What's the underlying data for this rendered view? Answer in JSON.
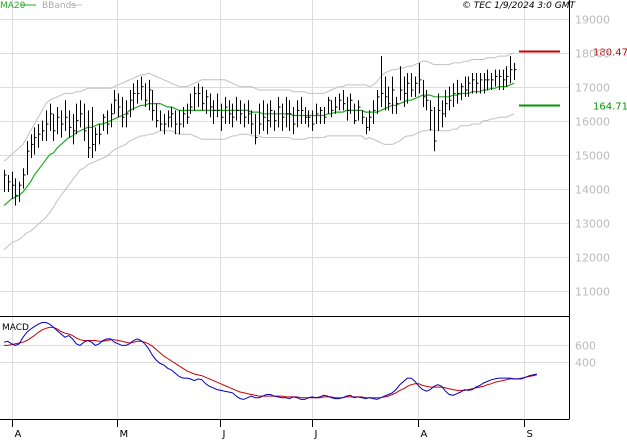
{
  "header": {
    "copyright": "© TEC 1/9/2024 3:0 GMT",
    "legend_ma20": "MA20",
    "legend_bbands": "BBands"
  },
  "colors": {
    "price": "#000000",
    "ma20": "#22aa22",
    "bands": "#c0c0c0",
    "macd_line": "#0000cc",
    "signal_line": "#cc0000",
    "resistance": "#cc0000",
    "support": "#009900",
    "ticks": "#bbbbbb"
  },
  "chart_data": [
    {
      "type": "line",
      "title": "",
      "y_ticks": [
        "19000",
        "18000",
        "17000",
        "16000",
        "15000",
        "14000",
        "13000",
        "12000",
        "11000"
      ],
      "y_tick_values": [
        19000,
        18000,
        17000,
        16000,
        15000,
        14000,
        13000,
        12000,
        11000
      ],
      "ylim": [
        10250,
        19550
      ],
      "x_months": [
        "A",
        "M",
        "J",
        "J",
        "A",
        "S"
      ],
      "price_high": [
        14550,
        14400,
        14500,
        14300,
        14200,
        14600,
        15400,
        15600,
        15800,
        15900,
        16000,
        16300,
        16500,
        16200,
        16400,
        16300,
        16600,
        16300,
        16200,
        16500,
        16600,
        16500,
        16300,
        16400,
        15800,
        15900,
        16200,
        16300,
        16500,
        16900,
        16800,
        16700,
        16600,
        16900,
        17100,
        17200,
        17300,
        17100,
        17200,
        16900,
        16500,
        16300,
        16200,
        16300,
        16400,
        16300,
        16300,
        16400,
        16500,
        16800,
        17000,
        17100,
        17000,
        16900,
        16800,
        16600,
        16800,
        16500,
        16700,
        16600,
        16500,
        16700,
        16600,
        16500,
        16600,
        16300,
        16200,
        16500,
        16600,
        16500,
        16600,
        16300,
        16700,
        16500,
        16700,
        16600,
        16400,
        16600,
        16700,
        16400,
        16300,
        16300,
        16500,
        16400,
        16400,
        16700,
        16600,
        16700,
        16800,
        16900,
        16700,
        16800,
        16500,
        16600,
        16300,
        16100,
        16300,
        16600,
        16900,
        17900,
        17300,
        17000,
        17300,
        16700,
        17600,
        17300,
        17400,
        17400,
        17300,
        17700,
        17200,
        16900,
        16600,
        16400,
        16800,
        16600,
        16900,
        17000,
        17100,
        17200,
        17100,
        17300,
        17300,
        17400,
        17400,
        17400,
        17400,
        17500,
        17400,
        17500,
        17500,
        17500,
        17600,
        17900,
        17700
      ],
      "price_low": [
        13900,
        13900,
        13700,
        13500,
        13600,
        14000,
        14400,
        14900,
        15000,
        15200,
        15400,
        15400,
        15700,
        15400,
        15600,
        15500,
        15700,
        15500,
        15300,
        15600,
        15800,
        15400,
        14900,
        14900,
        15100,
        15300,
        15700,
        15600,
        15800,
        16200,
        16100,
        15800,
        15800,
        16100,
        16300,
        16500,
        16600,
        16400,
        16300,
        16000,
        15800,
        15700,
        15600,
        15800,
        15800,
        15600,
        15600,
        15800,
        15900,
        16200,
        16300,
        16400,
        16300,
        16200,
        16100,
        15900,
        16100,
        15700,
        15900,
        15900,
        15800,
        16000,
        15900,
        15800,
        15900,
        15600,
        15300,
        15600,
        15700,
        15600,
        15800,
        15700,
        15800,
        15700,
        15800,
        15700,
        15600,
        15800,
        15900,
        15900,
        15800,
        15700,
        15900,
        15900,
        15900,
        16200,
        16100,
        16200,
        16300,
        16300,
        16000,
        16200,
        15900,
        16000,
        15900,
        15600,
        15700,
        15900,
        16200,
        16400,
        16300,
        16300,
        16200,
        16200,
        16600,
        16400,
        16500,
        16700,
        16700,
        16800,
        16400,
        16300,
        15700,
        15100,
        15700,
        15800,
        16100,
        16300,
        16400,
        16500,
        16600,
        16700,
        16700,
        16800,
        16800,
        16800,
        16800,
        16900,
        16900,
        17000,
        16900,
        16900,
        17000,
        17100,
        17200
      ],
      "price_close": [
        14400,
        14200,
        14100,
        13800,
        14100,
        14400,
        15100,
        15300,
        15500,
        15600,
        15700,
        15900,
        16200,
        15700,
        16100,
        15900,
        16100,
        15800,
        15700,
        16000,
        16200,
        15700,
        15200,
        15300,
        15600,
        15600,
        16100,
        15900,
        16200,
        16600,
        16400,
        16100,
        16200,
        16600,
        16800,
        16800,
        17000,
        16600,
        16900,
        16300,
        16000,
        15900,
        15900,
        16100,
        16200,
        15900,
        15900,
        16200,
        16100,
        16400,
        16800,
        16800,
        16500,
        16700,
        16400,
        16300,
        16300,
        16100,
        16400,
        16200,
        16100,
        16300,
        16200,
        16100,
        16200,
        15900,
        15500,
        15900,
        16100,
        16000,
        16300,
        16000,
        16400,
        16100,
        16200,
        16200,
        15900,
        16300,
        16300,
        16100,
        16100,
        15900,
        16200,
        16300,
        16100,
        16600,
        16300,
        16400,
        16600,
        16500,
        16300,
        16600,
        16000,
        16400,
        16100,
        15800,
        16100,
        16300,
        16700,
        16800,
        16700,
        16500,
        16900,
        16500,
        16900,
        16800,
        17100,
        16900,
        17100,
        17200,
        16700,
        16600,
        16300,
        15400,
        16300,
        16200,
        16500,
        16600,
        16800,
        16800,
        17000,
        16900,
        17100,
        17200,
        17100,
        17200,
        17200,
        17200,
        17200,
        17300,
        17300,
        17200,
        17300,
        17500,
        17500
      ],
      "ma20": [
        13500,
        13600,
        13700,
        13750,
        13800,
        13900,
        14050,
        14200,
        14400,
        14550,
        14700,
        14850,
        15000,
        15050,
        15200,
        15300,
        15400,
        15500,
        15550,
        15650,
        15700,
        15750,
        15800,
        15800,
        15850,
        15900,
        15900,
        15950,
        16000,
        16050,
        16100,
        16150,
        16200,
        16300,
        16350,
        16400,
        16450,
        16450,
        16500,
        16500,
        16500,
        16500,
        16450,
        16400,
        16400,
        16350,
        16300,
        16300,
        16300,
        16300,
        16300,
        16300,
        16300,
        16300,
        16300,
        16300,
        16300,
        16300,
        16300,
        16300,
        16300,
        16300,
        16300,
        16300,
        16300,
        16250,
        16250,
        16250,
        16200,
        16200,
        16200,
        16200,
        16200,
        16200,
        16200,
        16200,
        16150,
        16150,
        16150,
        16150,
        16150,
        16150,
        16150,
        16150,
        16150,
        16200,
        16200,
        16250,
        16250,
        16250,
        16300,
        16300,
        16300,
        16300,
        16300,
        16250,
        16250,
        16250,
        16250,
        16300,
        16350,
        16400,
        16450,
        16450,
        16500,
        16550,
        16600,
        16600,
        16650,
        16700,
        16750,
        16750,
        16750,
        16700,
        16700,
        16700,
        16700,
        16700,
        16750,
        16750,
        16800,
        16800,
        16800,
        16850,
        16850,
        16850,
        16900,
        16900,
        16950,
        16950,
        17000,
        17000,
        17000,
        17050,
        17100
      ],
      "bb_upper": [
        14800,
        14900,
        15000,
        15100,
        15200,
        15300,
        15500,
        15700,
        15900,
        16100,
        16300,
        16500,
        16600,
        16650,
        16700,
        16750,
        16800,
        16800,
        16800,
        16850,
        16850,
        16900,
        16950,
        16950,
        16950,
        16950,
        16950,
        16950,
        16950,
        17000,
        17050,
        17100,
        17150,
        17200,
        17250,
        17300,
        17350,
        17350,
        17400,
        17350,
        17300,
        17250,
        17200,
        17150,
        17100,
        17050,
        17000,
        17000,
        17000,
        17050,
        17100,
        17150,
        17200,
        17200,
        17200,
        17200,
        17200,
        17200,
        17200,
        17150,
        17100,
        17050,
        17000,
        17000,
        17000,
        17000,
        16950,
        16900,
        16900,
        16900,
        16900,
        16900,
        16900,
        16900,
        16900,
        16900,
        16850,
        16850,
        16850,
        16850,
        16800,
        16800,
        16800,
        16800,
        16800,
        16850,
        16900,
        16950,
        17000,
        17000,
        17050,
        17050,
        17050,
        17050,
        17050,
        17050,
        17000,
        17050,
        17150,
        17300,
        17400,
        17450,
        17500,
        17500,
        17550,
        17550,
        17600,
        17600,
        17650,
        17700,
        17750,
        17750,
        17700,
        17650,
        17650,
        17650,
        17650,
        17650,
        17700,
        17700,
        17700,
        17750,
        17750,
        17800,
        17800,
        17800,
        17800,
        17850,
        17850,
        17850,
        17900,
        17900,
        17900,
        17950,
        18000
      ],
      "bb_lower": [
        12200,
        12300,
        12400,
        12450,
        12500,
        12600,
        12700,
        12750,
        12850,
        12950,
        13050,
        13150,
        13300,
        13450,
        13650,
        13800,
        13950,
        14100,
        14250,
        14400,
        14550,
        14600,
        14700,
        14750,
        14800,
        14850,
        14900,
        14950,
        15050,
        15150,
        15200,
        15250,
        15300,
        15400,
        15450,
        15500,
        15550,
        15550,
        15600,
        15600,
        15650,
        15700,
        15700,
        15700,
        15700,
        15650,
        15600,
        15600,
        15600,
        15600,
        15550,
        15500,
        15450,
        15450,
        15450,
        15450,
        15450,
        15450,
        15450,
        15500,
        15550,
        15550,
        15600,
        15600,
        15600,
        15550,
        15550,
        15550,
        15500,
        15500,
        15500,
        15500,
        15500,
        15500,
        15500,
        15500,
        15450,
        15450,
        15450,
        15450,
        15500,
        15500,
        15500,
        15500,
        15500,
        15550,
        15550,
        15550,
        15550,
        15550,
        15550,
        15550,
        15550,
        15550,
        15550,
        15450,
        15500,
        15450,
        15400,
        15350,
        15300,
        15300,
        15300,
        15350,
        15400,
        15500,
        15550,
        15550,
        15600,
        15650,
        15700,
        15700,
        15750,
        15700,
        15700,
        15700,
        15700,
        15700,
        15750,
        15750,
        15850,
        15850,
        15850,
        15900,
        15900,
        15900,
        16000,
        16000,
        16050,
        16050,
        16100,
        16100,
        16100,
        16150,
        16200
      ],
      "levels": [
        {
          "name": "resistance",
          "value": 18047,
          "label": "180.47"
        },
        {
          "name": "support",
          "value": 16471,
          "label": "164.71"
        }
      ]
    },
    {
      "type": "line",
      "title": "MACD",
      "y_ticks": [
        "600",
        "400"
      ],
      "y_tick_values": [
        600,
        400
      ],
      "ylim": [
        -300,
        960
      ],
      "macd": [
        640,
        650,
        620,
        600,
        620,
        700,
        760,
        800,
        830,
        860,
        880,
        880,
        860,
        820,
        780,
        740,
        700,
        720,
        680,
        620,
        600,
        640,
        660,
        640,
        600,
        620,
        660,
        680,
        680,
        640,
        620,
        600,
        600,
        620,
        660,
        680,
        660,
        620,
        560,
        480,
        420,
        380,
        360,
        320,
        300,
        260,
        220,
        200,
        200,
        190,
        170,
        190,
        180,
        130,
        100,
        80,
        60,
        50,
        40,
        30,
        20,
        -20,
        -50,
        -60,
        -40,
        -20,
        -40,
        -40,
        -20,
        0,
        0,
        -20,
        -30,
        -40,
        -40,
        -50,
        -30,
        -40,
        -60,
        -60,
        -40,
        -30,
        -40,
        -30,
        -10,
        -20,
        -40,
        -50,
        -50,
        -40,
        -20,
        -10,
        -40,
        -30,
        -40,
        -50,
        -40,
        -50,
        -60,
        -40,
        -20,
        0,
        20,
        60,
        120,
        160,
        200,
        200,
        160,
        100,
        60,
        40,
        60,
        100,
        120,
        100,
        40,
        0,
        -10,
        10,
        30,
        60,
        50,
        60,
        90,
        110,
        140,
        160,
        180,
        190,
        200,
        200,
        200,
        200,
        190,
        190,
        190,
        210,
        230,
        240,
        250
      ],
      "signal": [
        600,
        600,
        610,
        620,
        630,
        640,
        660,
        690,
        720,
        760,
        790,
        810,
        820,
        820,
        800,
        770,
        750,
        740,
        720,
        690,
        670,
        660,
        660,
        660,
        660,
        650,
        650,
        660,
        670,
        670,
        660,
        650,
        640,
        630,
        640,
        650,
        650,
        640,
        620,
        590,
        550,
        510,
        470,
        440,
        410,
        380,
        350,
        320,
        290,
        270,
        250,
        240,
        230,
        210,
        190,
        170,
        150,
        130,
        110,
        90,
        70,
        50,
        30,
        20,
        10,
        0,
        -10,
        -20,
        -20,
        -20,
        -20,
        -20,
        -20,
        -20,
        -30,
        -30,
        -30,
        -30,
        -40,
        -40,
        -40,
        -40,
        -40,
        -40,
        -30,
        -30,
        -30,
        -40,
        -40,
        -40,
        -30,
        -30,
        -30,
        -30,
        -30,
        -40,
        -40,
        -40,
        -40,
        -40,
        -30,
        -20,
        0,
        20,
        50,
        70,
        100,
        120,
        130,
        130,
        110,
        100,
        90,
        90,
        90,
        90,
        80,
        70,
        60,
        50,
        50,
        50,
        60,
        70,
        80,
        90,
        100,
        120,
        130,
        150,
        160,
        170,
        180,
        190,
        190,
        190,
        200,
        210,
        220,
        230,
        240
      ]
    }
  ]
}
